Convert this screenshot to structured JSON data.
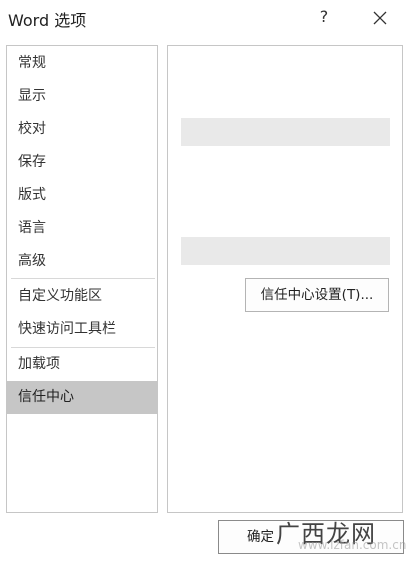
{
  "dialog": {
    "title": "Word 选项",
    "help_label": "?",
    "close_icon": "close-icon"
  },
  "sidebar": {
    "items": [
      {
        "label": "常规",
        "selected": false
      },
      {
        "label": "显示",
        "selected": false
      },
      {
        "label": "校对",
        "selected": false
      },
      {
        "label": "保存",
        "selected": false
      },
      {
        "label": "版式",
        "selected": false
      },
      {
        "label": "语言",
        "selected": false
      },
      {
        "label": "高级",
        "selected": false
      },
      {
        "label": "自定义功能区",
        "selected": false
      },
      {
        "label": "快速访问工具栏",
        "selected": false
      },
      {
        "label": "加载项",
        "selected": false
      },
      {
        "label": "信任中心",
        "selected": true
      }
    ]
  },
  "content": {
    "trust_center_button": "信任中心设置(T)..."
  },
  "footer": {
    "ok_label": "确定"
  },
  "watermark": {
    "brand": "广西龙网",
    "site": "www.lzfan.com.cn"
  },
  "colors": {
    "selected_background": "#c6c6c6",
    "border": "#c6c6c6",
    "placeholder_bar": "#e9e9e9"
  }
}
